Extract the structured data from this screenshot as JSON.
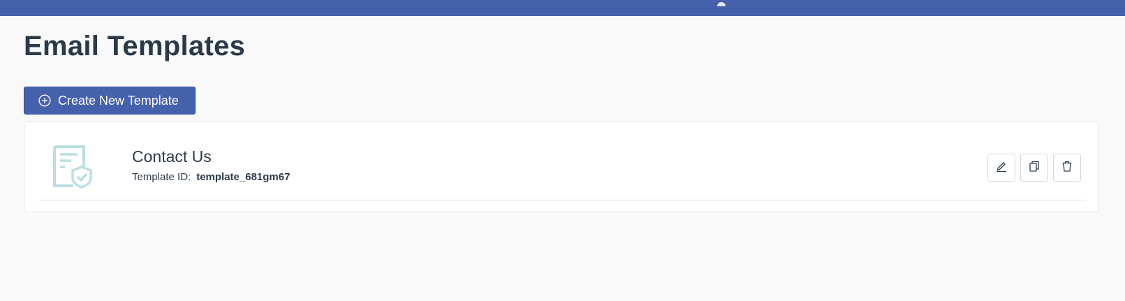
{
  "page": {
    "title": "Email Templates"
  },
  "toolbar": {
    "create_label": "Create New Template",
    "create_icon": "plus-circle-icon"
  },
  "templates": [
    {
      "name": "Contact Us",
      "id_label": "Template ID:",
      "id_value": "template_681gm67",
      "icon": "document-shield-icon",
      "actions": [
        "edit-icon",
        "copy-icon",
        "trash-icon"
      ]
    }
  ],
  "colors": {
    "brand": "#4561ab",
    "background": "#f9f9f9",
    "text": "#2b3a4a",
    "icon_light": "#b9dfe3"
  }
}
